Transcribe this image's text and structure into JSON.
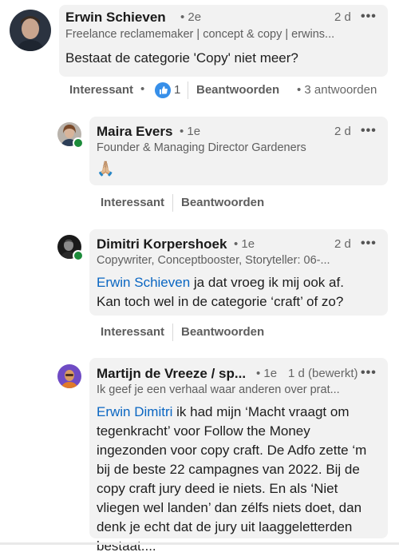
{
  "comments": [
    {
      "name": "Erwin Schieven",
      "degree": "• 2e",
      "time": "2 d",
      "more": "•••",
      "headline": "Freelance reclamemaker | concept & copy | erwins...",
      "text": "Bestaat de categorie 'Copy' niet meer?",
      "actions": {
        "like": "Interessant",
        "dot": "•",
        "reaction_count": "1",
        "reply": "Beantwoorden",
        "replies": "• 3 antwoorden"
      }
    },
    {
      "name": "Maira Evers",
      "degree": "• 1e",
      "time": "2 d",
      "more": "•••",
      "headline": "Founder & Managing Director Gardeners",
      "emoji": "🙏🏼",
      "actions": {
        "like": "Interessant",
        "reply": "Beantwoorden"
      }
    },
    {
      "name": "Dimitri Korpershoek",
      "degree": "• 1e",
      "time": "2 d",
      "more": "•••",
      "headline": "Copywriter, Conceptbooster, Storyteller: 06-...",
      "mention": "Erwin Schieven",
      "text_line1": " ja dat vroeg ik mij ook af.",
      "text_line2": "Kan toch wel in de categorie ‘craft’ of zo?",
      "actions": {
        "like": "Interessant",
        "reply": "Beantwoorden"
      }
    },
    {
      "name": "Martijn de Vreeze / sp...",
      "degree": "• 1e",
      "time": "1 d (bewerkt)",
      "more": "•••",
      "headline": "Ik geef je een verhaal waar anderen over prat...",
      "mention": "Erwin Dimitri",
      "lines": [
        " ik had mijn ‘Macht vraagt om",
        "tegenkracht’ voor Follow the Money",
        "ingezonden voor copy craft. De Adfo zette ‘m",
        "bij de beste 22 campagnes van 2022. Bij de",
        "copy craft jury deed ie niets. En als ‘Niet",
        "vliegen wel landen’ dan zélfs niets doet, dan",
        "denk je echt dat de jury uit laaggeletterden",
        "bestaat...."
      ]
    }
  ],
  "colors": {
    "accent": "#0a66c2",
    "bubble": "#f2f2f2",
    "online": "#1c8b3a"
  }
}
